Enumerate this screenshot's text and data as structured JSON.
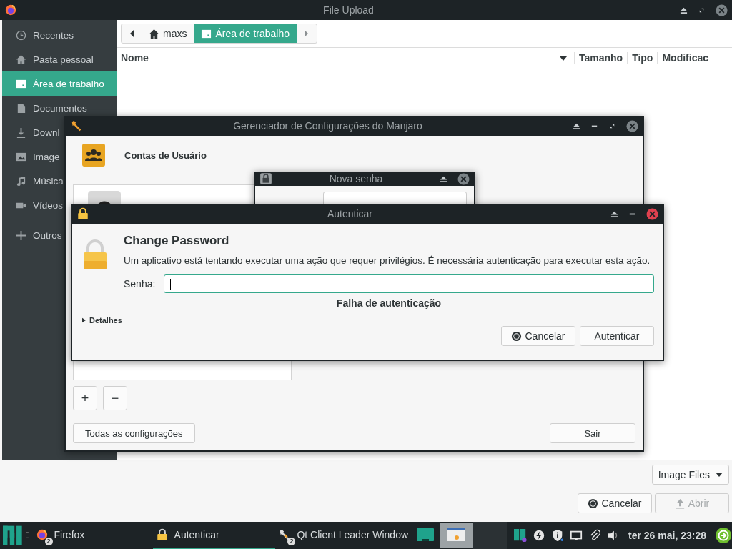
{
  "file_dialog": {
    "title": "File Upload",
    "sidebar": [
      {
        "label": "Recentes",
        "selected": false
      },
      {
        "label": "Pasta pessoal",
        "selected": false
      },
      {
        "label": "Área de trabalho",
        "selected": true
      },
      {
        "label": "Documentos",
        "selected": false
      },
      {
        "label": "Downl",
        "selected": false
      },
      {
        "label": "Image",
        "selected": false
      },
      {
        "label": "Música",
        "selected": false
      },
      {
        "label": "Vídeos",
        "selected": false
      },
      {
        "label": "Outros",
        "selected": false
      }
    ],
    "path": [
      {
        "label": "maxs",
        "kind": "home",
        "selected": false
      },
      {
        "label": "Área de trabalho",
        "kind": "desktop",
        "selected": true
      }
    ],
    "columns": [
      "Nome",
      "Tamanho",
      "Tipo",
      "Modificac"
    ],
    "filter": "Image Files",
    "buttons": [
      {
        "label": "Cancelar",
        "kind": "cancel",
        "disabled": false
      },
      {
        "label": "Abrir",
        "kind": "open",
        "disabled": true
      }
    ]
  },
  "settings_window": {
    "title": "Gerenciador de Configurações do Manjaro",
    "heading": "Contas de Usuário",
    "add": "+",
    "remove": "−",
    "all_settings": "Todas as configurações",
    "quit": "Sair"
  },
  "password_window": {
    "title": "Nova senha"
  },
  "auth_dialog": {
    "title": "Autenticar",
    "heading": "Change Password",
    "message": "Um aplicativo está tentando executar uma ação que requer privilégios. É necessária autenticação para executar esta ação.",
    "password_label": "Senha:",
    "error": "Falha de autenticação",
    "details": "Detalhes",
    "details_expanded": false,
    "buttons": [
      {
        "label": "Cancelar",
        "kind": "cancel"
      },
      {
        "label": "Autenticar",
        "kind": "default"
      }
    ]
  },
  "taskbar": {
    "tasks": [
      {
        "label": "Firefox",
        "badge": "2",
        "selected": false
      },
      {
        "label": "Autenticar",
        "selected": true
      },
      {
        "label": "Qt Client Leader Window",
        "badge": "2",
        "selected": false
      }
    ],
    "clock": "ter 26 mai, 23:28"
  }
}
